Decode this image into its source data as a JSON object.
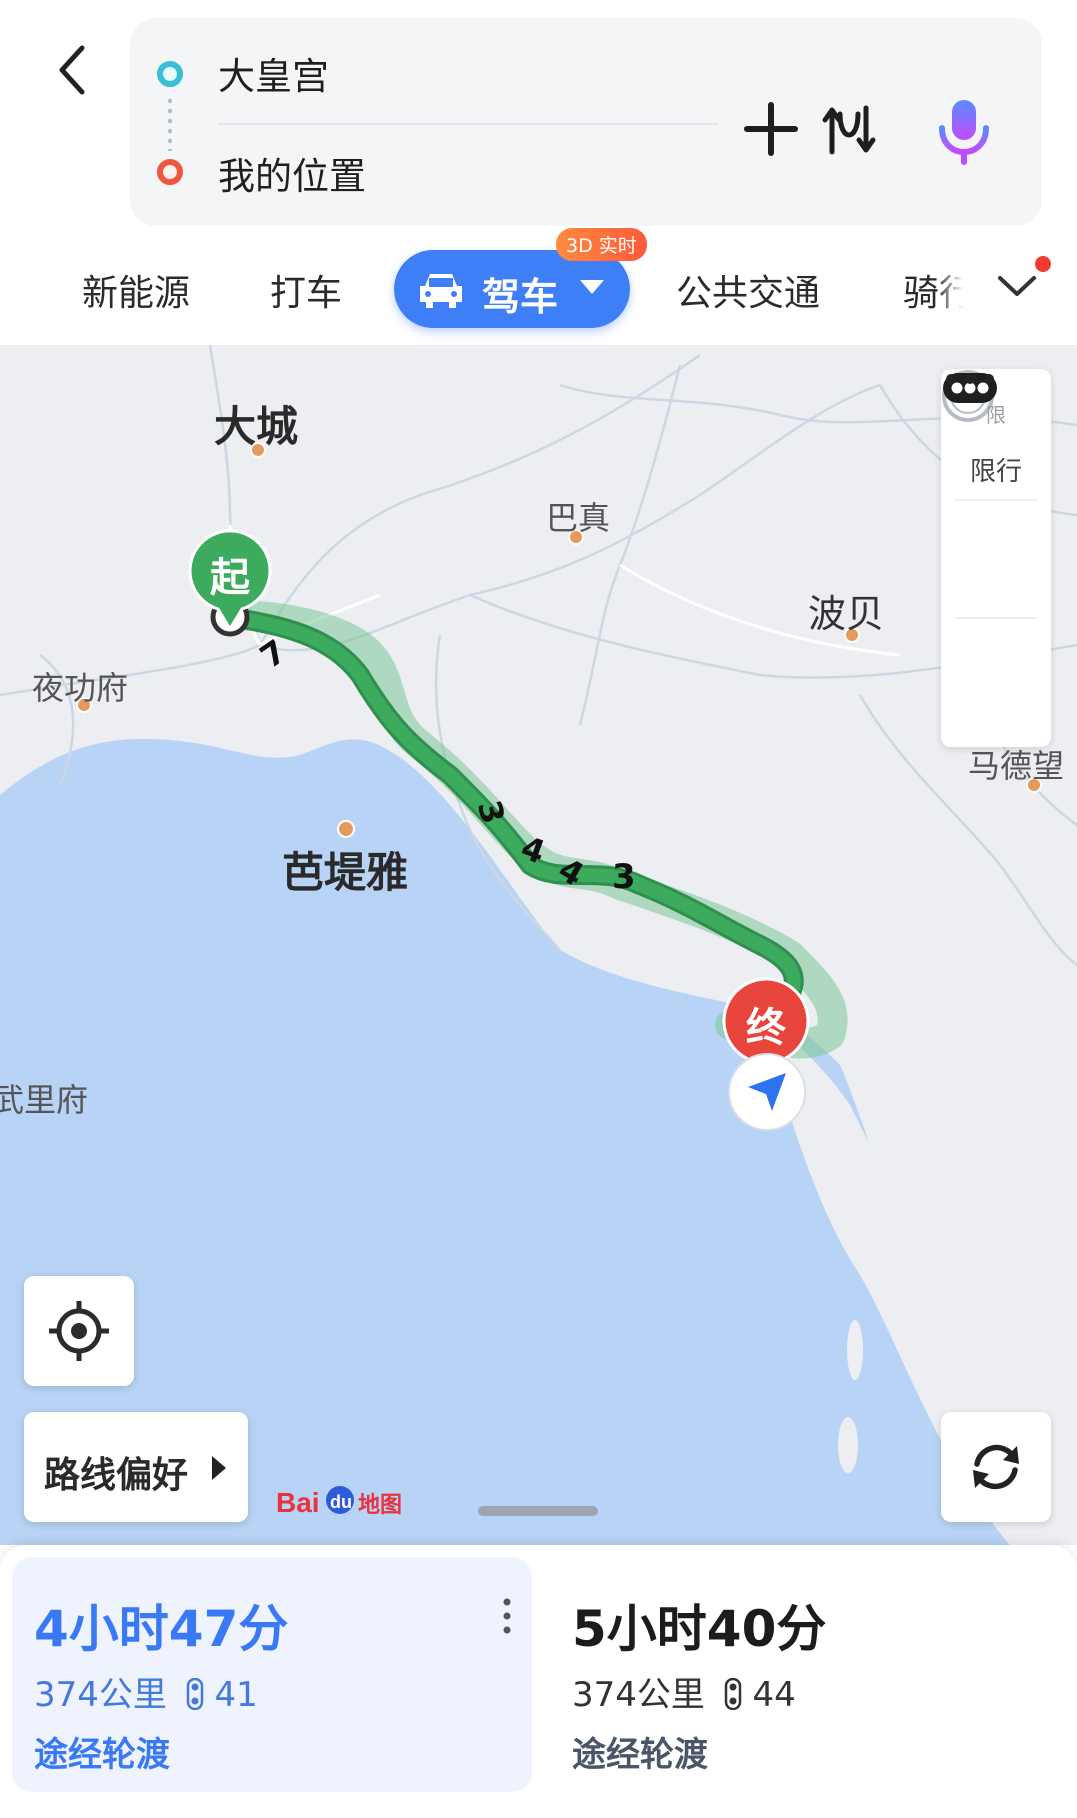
{
  "header": {
    "back_icon": "chevron-left-icon",
    "origin": "大皇宫",
    "destination": "我的位置",
    "add_icon": "plus-icon",
    "swap_icon": "swap-icon",
    "voice_icon": "microphone-icon"
  },
  "modes": {
    "items": [
      "新能源",
      "打车",
      "驾车",
      "公共交通",
      "骑行"
    ],
    "selected": "驾车",
    "badge": "3D 实时",
    "expand_icon": "chevron-down-icon"
  },
  "map": {
    "cities": {
      "dacheng": "大城",
      "bazhen": "巴真",
      "bobei": "波贝",
      "yegongfu": "夜功府",
      "batiya": "芭堤雅",
      "madewang": "马德望",
      "wulifu": "武里府"
    },
    "route_road_numbers": [
      "7",
      "3",
      "4",
      "4",
      "3"
    ],
    "start_marker": "起",
    "end_marker": "终",
    "side_panel": {
      "limit_label": "限行",
      "limit_glyph": "限"
    },
    "preference_button": "路线偏好",
    "logo": "Bai du 地图",
    "colors": {
      "water": "#b8d3f5",
      "land": "#eceef2",
      "route": "#3cab5e",
      "route_halo": "#7cc696",
      "accent": "#3e7ef7"
    }
  },
  "routes": [
    {
      "time": "4小时47分",
      "distance": "374公里",
      "lights": "41",
      "note": "途经轮渡",
      "selected": true
    },
    {
      "time": "5小时40分",
      "distance": "374公里",
      "lights": "44",
      "note": "途经轮渡",
      "selected": false
    }
  ]
}
